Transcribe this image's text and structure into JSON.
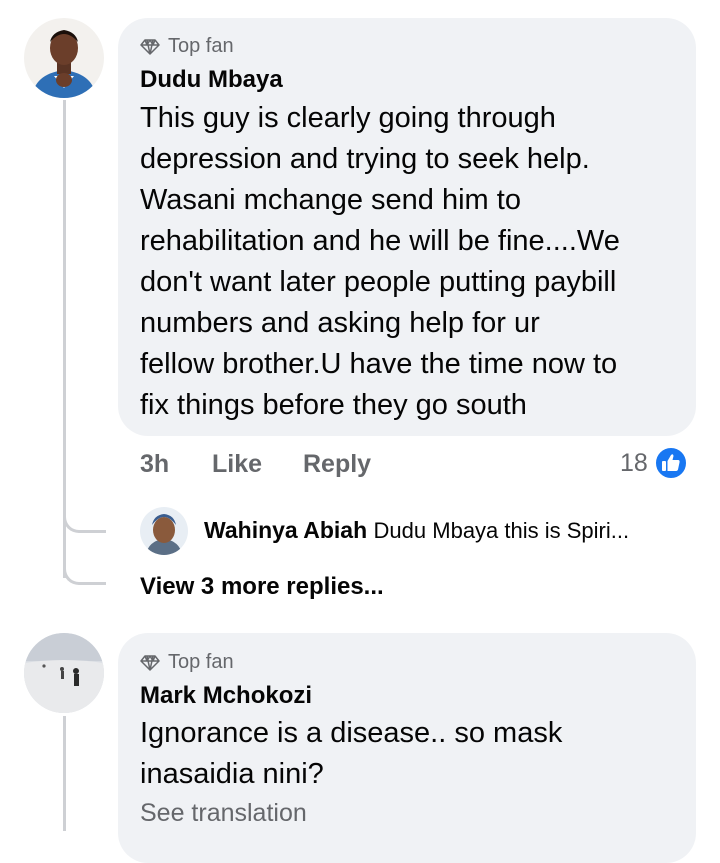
{
  "comments": [
    {
      "badge": "Top fan",
      "author": "Dudu Mbaya",
      "lines": [
        "This guy is clearly going through",
        "depression and trying to seek help.",
        "Wasani mchange send him to",
        "rehabilitation and he will be fine....We",
        "don't want later people putting paybill",
        "numbers and asking help for ur",
        "fellow brother.U have the time now to",
        "fix things before they go south"
      ],
      "time": "3h",
      "like_label": "Like",
      "reply_label": "Reply",
      "reaction_count": "18",
      "reaction_icon": "like-thumb-icon",
      "reply": {
        "author": "Wahinya Abiah",
        "snippet": "Dudu Mbaya this is Spiri..."
      },
      "more_replies": "View 3 more replies..."
    },
    {
      "badge": "Top fan",
      "author": "Mark Mchokozi",
      "lines": [
        "Ignorance is a disease.. so mask",
        "inasaidia nini?"
      ],
      "see_translation": "See translation"
    }
  ],
  "colors": {
    "like_blue": "#1877f2",
    "bubble_bg": "#f0f2f5",
    "secondary_text": "#65676b",
    "thread_line": "#ced0d4"
  }
}
